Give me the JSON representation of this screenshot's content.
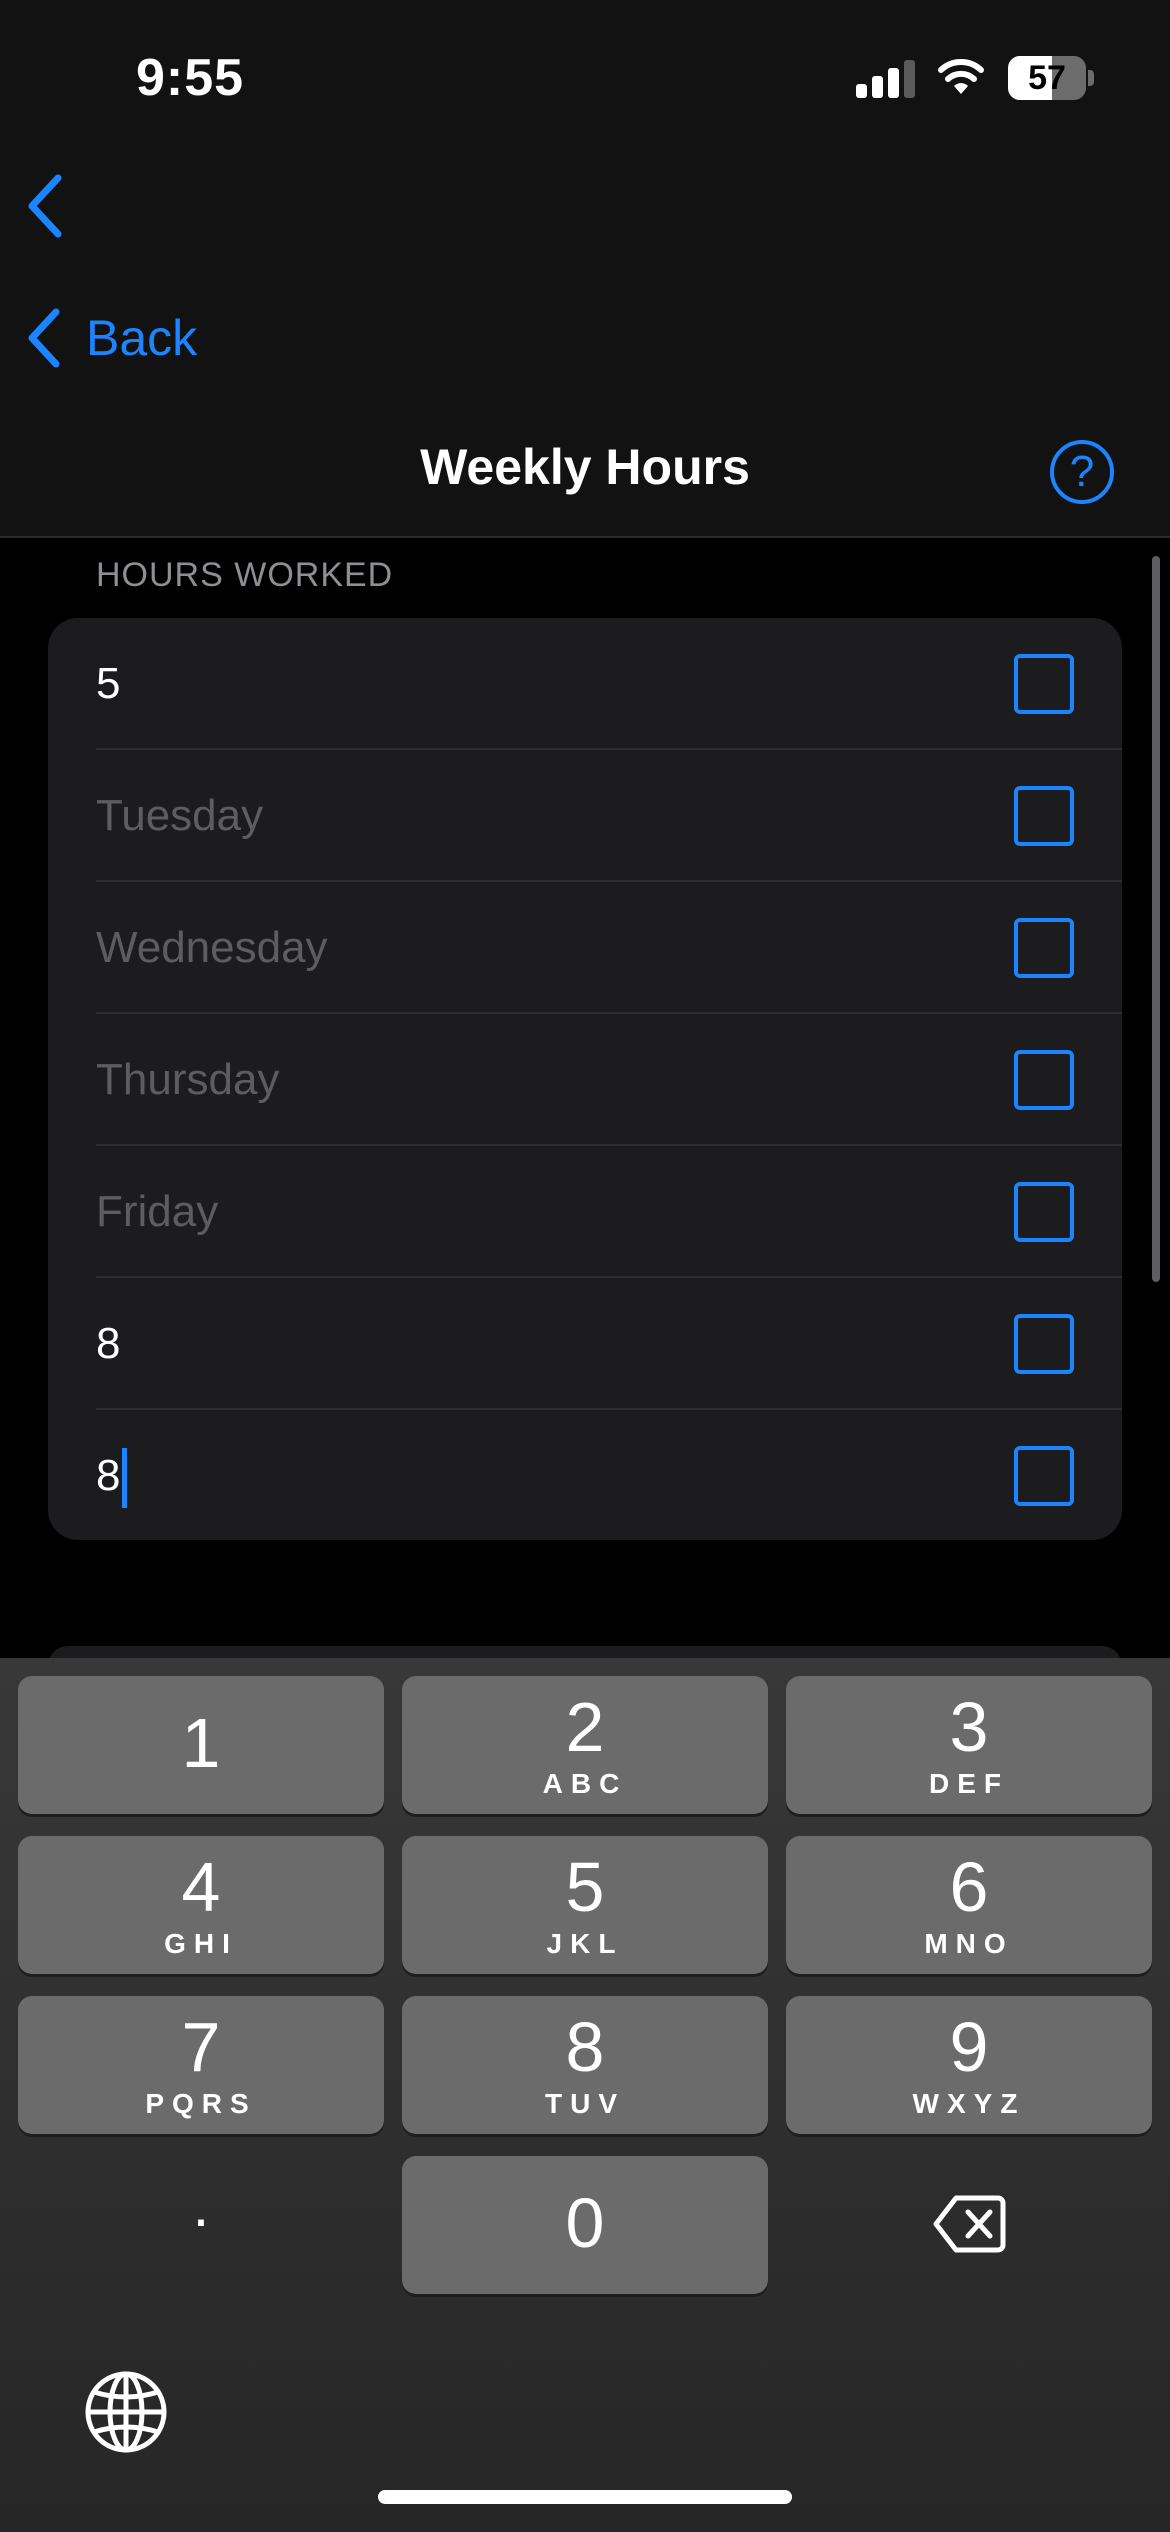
{
  "status_bar": {
    "time": "9:55",
    "battery": "57",
    "battery_level": 0.57
  },
  "nav": {
    "back_label": "Back",
    "title": "Weekly Hours",
    "help_symbol": "?"
  },
  "section": {
    "header": "HOURS WORKED"
  },
  "rows": [
    {
      "text": "5",
      "is_placeholder": false
    },
    {
      "text": "Tuesday",
      "is_placeholder": true
    },
    {
      "text": "Wednesday",
      "is_placeholder": true
    },
    {
      "text": "Thursday",
      "is_placeholder": true
    },
    {
      "text": "Friday",
      "is_placeholder": true
    },
    {
      "text": "8",
      "is_placeholder": false
    },
    {
      "text": "8",
      "is_placeholder": false,
      "focused": true
    }
  ],
  "keyboard": {
    "keys": [
      {
        "num": "1",
        "letters": ""
      },
      {
        "num": "2",
        "letters": "ABC"
      },
      {
        "num": "3",
        "letters": "DEF"
      },
      {
        "num": "4",
        "letters": "GHI"
      },
      {
        "num": "5",
        "letters": "JKL"
      },
      {
        "num": "6",
        "letters": "MNO"
      },
      {
        "num": "7",
        "letters": "PQRS"
      },
      {
        "num": "8",
        "letters": "TUV"
      },
      {
        "num": "9",
        "letters": "WXYZ"
      },
      {
        "num": "0",
        "letters": ""
      }
    ],
    "decimal": "."
  },
  "icons": {
    "back": "chevron-left-icon",
    "help": "question-circle-icon",
    "delete": "backspace-icon",
    "globe": "globe-icon"
  },
  "colors": {
    "accent": "#1b84ff",
    "background": "#000000",
    "card": "#1c1c1e",
    "key": "#6b6b6b"
  }
}
